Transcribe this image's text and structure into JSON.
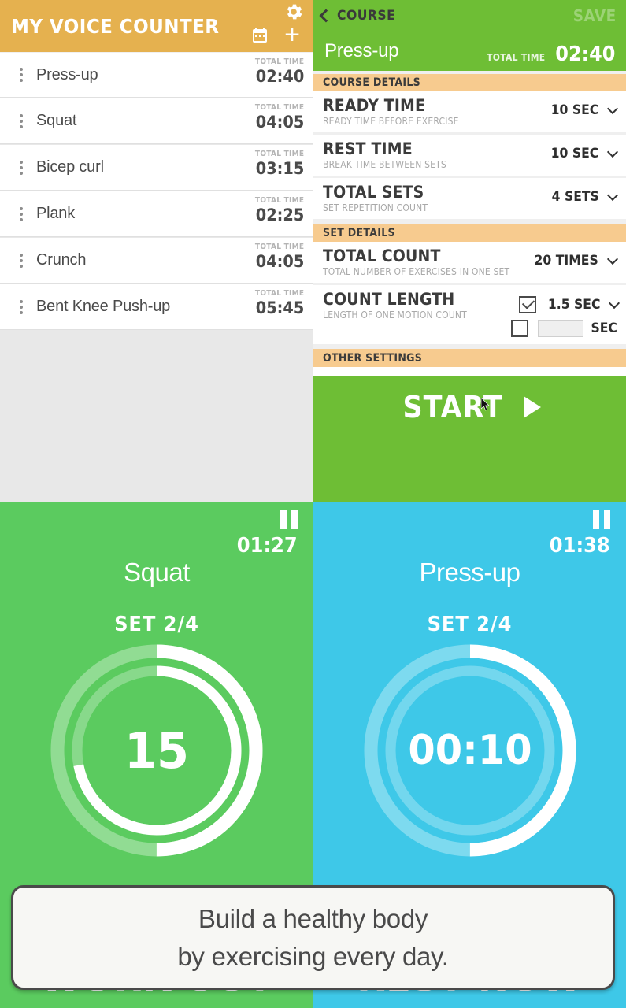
{
  "list_screen": {
    "app_title": "MY VOICE COUNTER",
    "icons": {
      "gear": "gear-icon",
      "calendar": "calendar-icon",
      "add": "+"
    },
    "total_time_label": "TOTAL TIME",
    "exercises": [
      {
        "name": "Press-up",
        "total_time": "02:40"
      },
      {
        "name": "Squat",
        "total_time": "04:05"
      },
      {
        "name": "Bicep curl",
        "total_time": "03:15"
      },
      {
        "name": "Plank",
        "total_time": "02:25"
      },
      {
        "name": "Crunch",
        "total_time": "04:05"
      },
      {
        "name": "Bent Knee Push-up",
        "total_time": "05:45"
      }
    ]
  },
  "course_screen": {
    "back_label": "COURSE",
    "save_label": "SAVE",
    "course_name": "Press-up",
    "total_time_label": "TOTAL TIME",
    "total_time_value": "02:40",
    "sections": [
      {
        "title": "COURSE DETAILS"
      },
      {
        "title": "SET DETAILS"
      },
      {
        "title": "OTHER SETTINGS"
      }
    ],
    "course_details": [
      {
        "title": "READY TIME",
        "subtitle": "READY TIME BEFORE EXERCISE",
        "value": "10 SEC"
      },
      {
        "title": "REST TIME",
        "subtitle": "BREAK TIME BETWEEN SETS",
        "value": "10 SEC"
      },
      {
        "title": "TOTAL SETS",
        "subtitle": "SET REPETITION COUNT",
        "value": "4 SETS"
      }
    ],
    "set_details": [
      {
        "title": "TOTAL COUNT",
        "subtitle": "TOTAL NUMBER OF EXERCISES IN ONE SET",
        "value": "20 TIMES"
      }
    ],
    "count_length": {
      "title": "COUNT LENGTH",
      "subtitle": "LENGTH OF ONE MOTION COUNT",
      "preset_checked": true,
      "preset_value": "1.5 SEC",
      "custom_checked": false,
      "custom_value": "",
      "custom_unit": "SEC"
    },
    "start_label": "START"
  },
  "workout_timer": {
    "clock": "01:27",
    "exercise_name": "Squat",
    "set_label": "SET  2/4",
    "count_value": "15",
    "state_label": "WORK OUT",
    "outer_progress_pct": 50,
    "inner_progress_pct": 72
  },
  "rest_timer": {
    "clock": "01:38",
    "exercise_name": "Press-up",
    "set_label": "SET  2/4",
    "count_value": "00:10",
    "state_label": "REST NOW",
    "outer_progress_pct": 50,
    "inner_progress_pct": 0
  },
  "banner": {
    "line1": "Build a healthy body",
    "line2": "by exercising every day."
  },
  "colors": {
    "header_orange": "#E5B14F",
    "section_band": "#F7CB8F",
    "green": "#6EBE35",
    "timer_green": "#5BCB5F",
    "timer_blue": "#3EC8E8",
    "list_bg": "#E8E8E8"
  }
}
